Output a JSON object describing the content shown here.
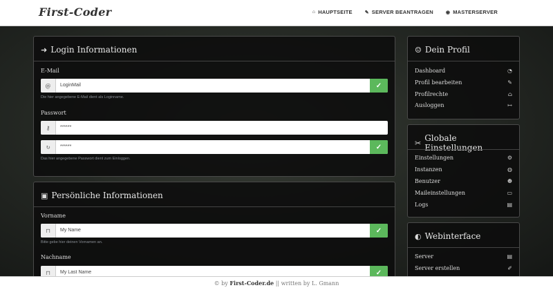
{
  "brand": "First-Coder",
  "nav": [
    {
      "icon": "home-icon",
      "glyph": "⌂",
      "label": "HAUPTSEITE"
    },
    {
      "icon": "edit-icon",
      "glyph": "✎",
      "label": "SERVER BEANTRAGEN"
    },
    {
      "icon": "eye-icon",
      "glyph": "◉",
      "label": "MASTERSERVER"
    }
  ],
  "login": {
    "title": "Login Informationen",
    "email_label": "E-Mail",
    "email_value": "LoginMail",
    "email_help": "Die hier angegebene E-Mail dient als Loginname.",
    "password_label": "Passwort",
    "password_value": "******",
    "password_repeat_value": "******",
    "password_help": "Das hier angegebene Passwort dient zum Einloggen."
  },
  "personal": {
    "title": "Persönliche Informationen",
    "firstname_label": "Vorname",
    "firstname_value": "My Name",
    "firstname_help": "Bitte gebe hier deinen Vornamen an.",
    "lastname_label": "Nachname",
    "lastname_value": "My Last Name"
  },
  "profile": {
    "title": "Dein Profil",
    "items": [
      {
        "label": "Dashboard",
        "icon": "dashboard-icon",
        "glyph": "◔"
      },
      {
        "label": "Profil bearbeiten",
        "icon": "edit-icon",
        "glyph": "✎"
      },
      {
        "label": "Profilrechte",
        "icon": "bank-icon",
        "glyph": "⌂"
      },
      {
        "label": "Ausloggen",
        "icon": "sign-out-icon",
        "glyph": "↦"
      }
    ]
  },
  "settings": {
    "title": "Globale Einstellungen",
    "items": [
      {
        "label": "Einstellungen",
        "icon": "cogs-icon",
        "glyph": "⚙"
      },
      {
        "label": "Instanzen",
        "icon": "globe-icon",
        "glyph": "◍"
      },
      {
        "label": "Benutzer",
        "icon": "users-icon",
        "glyph": "☻"
      },
      {
        "label": "Maileinstellungen",
        "icon": "inbox-icon",
        "glyph": "▭"
      },
      {
        "label": "Logs",
        "icon": "archive-icon",
        "glyph": "▤"
      }
    ]
  },
  "webinterface": {
    "title": "Webinterface",
    "items": [
      {
        "label": "Server",
        "icon": "server-icon",
        "glyph": "▤"
      },
      {
        "label": "Server erstellen",
        "icon": "paint-brush-icon",
        "glyph": "✐"
      }
    ]
  },
  "footer": {
    "prefix": "© by",
    "site": "First-Coder.de",
    "separator": "||",
    "written": "written by L. Gmann"
  }
}
